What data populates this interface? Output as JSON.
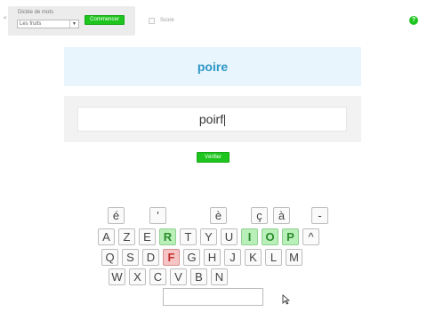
{
  "dictee": {
    "label": "Dictée de mots",
    "select_value": "Les fruits",
    "start_label": "Commencer"
  },
  "score_label": "Score",
  "help_label": "?",
  "word": "poire",
  "answer": "poirf",
  "verify_label": "Vérifier",
  "keyboard": {
    "accent_keys": [
      "é",
      "'",
      "è",
      "ç",
      "à",
      "-"
    ],
    "row1": [
      {
        "k": "A",
        "s": ""
      },
      {
        "k": "Z",
        "s": ""
      },
      {
        "k": "E",
        "s": ""
      },
      {
        "k": "R",
        "s": "correct"
      },
      {
        "k": "T",
        "s": ""
      },
      {
        "k": "Y",
        "s": ""
      },
      {
        "k": "U",
        "s": ""
      },
      {
        "k": "I",
        "s": "correct"
      },
      {
        "k": "O",
        "s": "correct"
      },
      {
        "k": "P",
        "s": "correct"
      },
      {
        "k": "^",
        "s": ""
      }
    ],
    "row2": [
      {
        "k": "Q",
        "s": ""
      },
      {
        "k": "S",
        "s": ""
      },
      {
        "k": "D",
        "s": ""
      },
      {
        "k": "F",
        "s": "wrong"
      },
      {
        "k": "G",
        "s": ""
      },
      {
        "k": "H",
        "s": ""
      },
      {
        "k": "J",
        "s": ""
      },
      {
        "k": "K",
        "s": ""
      },
      {
        "k": "L",
        "s": ""
      },
      {
        "k": "M",
        "s": ""
      }
    ],
    "row3": [
      {
        "k": "W",
        "s": ""
      },
      {
        "k": "X",
        "s": ""
      },
      {
        "k": "C",
        "s": ""
      },
      {
        "k": "V",
        "s": ""
      },
      {
        "k": "B",
        "s": ""
      },
      {
        "k": "N",
        "s": ""
      }
    ]
  }
}
